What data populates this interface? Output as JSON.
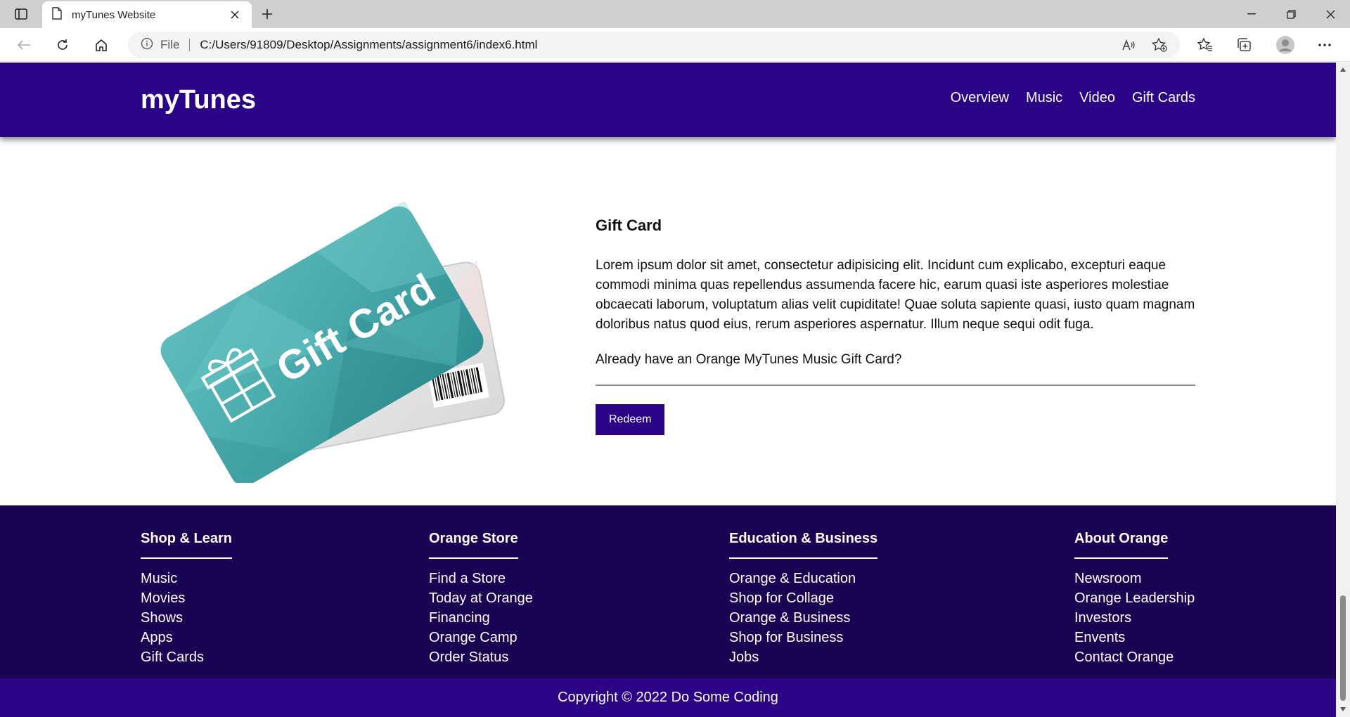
{
  "browser": {
    "tab_title": "myTunes Website",
    "file_label": "File",
    "url": "C:/Users/91809/Desktop/Assignments/assignment6/index6.html"
  },
  "site": {
    "brand": "myTunes",
    "nav": [
      "Overview",
      "Music",
      "Video",
      "Gift Cards"
    ],
    "accent_color": "#2a0386",
    "footer_color": "#1b0354"
  },
  "main": {
    "card_image_text": "Gift Card",
    "heading": "Gift Card",
    "description": "Lorem ipsum dolor sit amet, consectetur adipisicing elit. Incidunt cum explicabo, excepturi eaque commodi minima quas repellendus assumenda facere hic, earum quasi iste asperiores molestiae obcaecati laborum, voluptatum alias velit cupiditate! Quae soluta sapiente quasi, iusto quam magnam doloribus natus quod eius, rerum asperiores aspernatur. Illum neque sequi odit fuga.",
    "already_text": "Already have an Orange MyTunes Music Gift Card?",
    "redeem_label": "Redeem"
  },
  "footer": {
    "columns": [
      {
        "title": "Shop & Learn",
        "items": [
          "Music",
          "Movies",
          "Shows",
          "Apps",
          "Gift Cards"
        ]
      },
      {
        "title": "Orange Store",
        "items": [
          "Find a Store",
          "Today at Orange",
          "Financing",
          "Orange Camp",
          "Order Status"
        ]
      },
      {
        "title": "Education & Business",
        "items": [
          "Orange & Education",
          "Shop for Collage",
          "Orange & Business",
          "Shop for Business",
          "Jobs"
        ]
      },
      {
        "title": "About Orange",
        "items": [
          "Newsroom",
          "Orange Leadership",
          "Investors",
          "Envents",
          "Contact Orange"
        ]
      }
    ],
    "copyright": "Copyright © 2022 Do Some Coding"
  }
}
